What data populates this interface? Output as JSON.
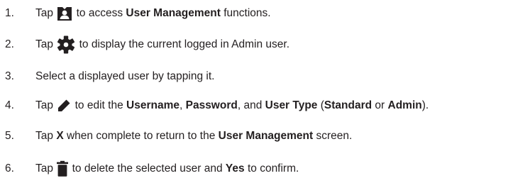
{
  "steps": [
    {
      "number": "1.",
      "t1": "Tap ",
      "icon": "user-badge-icon",
      "t2": " to access ",
      "b1": "User Management",
      "t3": " functions."
    },
    {
      "number": "2.",
      "t1": "Tap ",
      "icon": "gear-icon",
      "t2": " to display the current logged in Admin user."
    },
    {
      "number": "3.",
      "t1": "Select a displayed user by tapping it."
    },
    {
      "number": "4.",
      "t1": "Tap ",
      "icon": "pencil-icon",
      "t2": " to edit the ",
      "b1": "Username",
      "t3": ", ",
      "b2": "Password",
      "t4": ", and ",
      "b3": "User Type",
      "t5": " (",
      "b4": "Standard",
      "t6": " or ",
      "b5": "Admin",
      "t7": ")."
    },
    {
      "number": "5.",
      "t1": "Tap ",
      "b1": "X",
      "t2": " when complete to return to the ",
      "b2": "User Management",
      "t3": " screen."
    },
    {
      "number": "6.",
      "t1": "Tap ",
      "icon": "trash-icon",
      "t2": " to delete the selected user and ",
      "b1": "Yes",
      "t3": " to confirm."
    }
  ]
}
